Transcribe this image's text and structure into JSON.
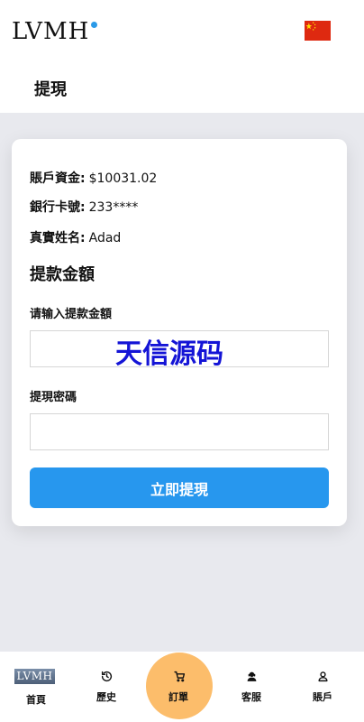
{
  "header": {
    "logo_text": "LVMH",
    "flag_icon": "china-flag-icon"
  },
  "page": {
    "title": "提現"
  },
  "account_info": {
    "balance_label": "賬戶資金:",
    "balance_value": "$10031.02",
    "card_label": "銀行卡號:",
    "card_value": "233****",
    "name_label": "真實姓名:",
    "name_value": "Adad"
  },
  "withdraw": {
    "section_title": "提款金額",
    "amount_label": "请输入提款金額",
    "amount_value": "",
    "password_label": "提現密碼",
    "password_value": "",
    "submit_label": "立即提現"
  },
  "watermark": {
    "text": "天信源码"
  },
  "bottom_nav": {
    "items": [
      {
        "label": "首頁",
        "icon": "home-logo-icon"
      },
      {
        "label": "歷史",
        "icon": "history-icon"
      },
      {
        "label": "訂單",
        "icon": "cart-icon"
      },
      {
        "label": "客服",
        "icon": "support-agent-icon"
      },
      {
        "label": "賬戶",
        "icon": "user-icon"
      }
    ]
  },
  "colors": {
    "accent": "#2797ee",
    "order_highlight": "#fcbd6b",
    "watermark": "#1414d6",
    "background": "#e8e9ee"
  }
}
